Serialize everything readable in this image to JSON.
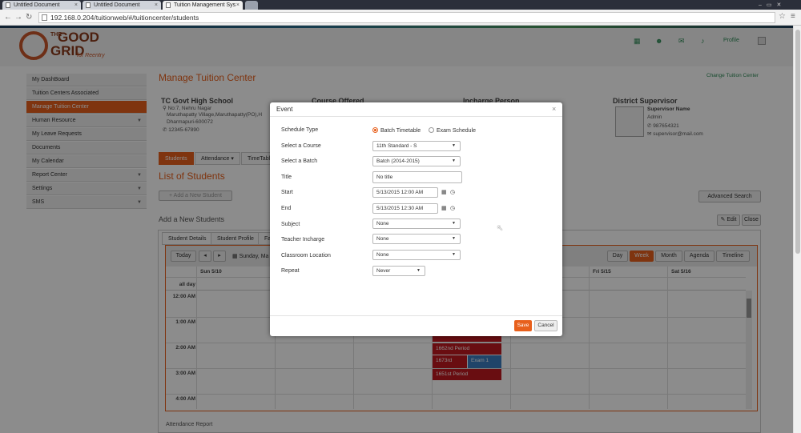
{
  "browser": {
    "tabs": [
      {
        "title": "Untitled Document"
      },
      {
        "title": "Untitled Document"
      },
      {
        "title": "Tuition Management Sys"
      }
    ],
    "url": "192.168.0.204/tuitionweb/#/tuitioncenter/students"
  },
  "header": {
    "logo_line1": "THE",
    "logo_line2": "GOOD",
    "logo_line3": "GRID",
    "logo_tagline": "for Reentry",
    "profile_label": "Profile"
  },
  "sidebar": {
    "items": [
      {
        "label": "My DashBoard"
      },
      {
        "label": "Tuition Centers Associated"
      },
      {
        "label": "Manage Tuition Center"
      },
      {
        "label": "Human Resource"
      },
      {
        "label": "My Leave Requests"
      },
      {
        "label": "Documents"
      },
      {
        "label": "My Calendar"
      },
      {
        "label": "Report Center"
      },
      {
        "label": "Settings"
      },
      {
        "label": "SMS"
      }
    ]
  },
  "main": {
    "page_title": "Manage Tuition Center",
    "change_center": "Change Tuition Center",
    "school": {
      "name": "TC Govt High School",
      "addr1": "No:7, Nehru Nagar",
      "addr2": "Maruthapatty Village,Maruthapatty(PO),H",
      "addr3": "Dharmapuri-600072",
      "phone": "12345-67890"
    },
    "course_offered": "Course Offered",
    "incharge": "Incharge Person",
    "district": {
      "heading": "District Supervisor",
      "name": "Supervisor Name",
      "role": "Admin",
      "phone": "987654321",
      "email": "supervisor@mail.com"
    },
    "tabs": [
      "Students",
      "Attendance",
      "TimeTabl"
    ],
    "list_title": "List of Students",
    "add_new_btn": "+ Add a New Student",
    "advanced_search": "Advanced Search",
    "add_new_heading": "Add a New Students",
    "edit": "Edit",
    "close": "Close",
    "subtabs": [
      "Student Details",
      "Student Profile",
      "Fa"
    ],
    "attendance_report": "Attendance Report"
  },
  "calendar": {
    "today": "Today",
    "prev": "◂",
    "next": "▸",
    "date_range": "Sunday, Ma",
    "views": [
      "Day",
      "Week",
      "Month",
      "Agenda",
      "Timeline"
    ],
    "active_view": "Week",
    "days": [
      "Sun 5/10",
      "Fri 5/15",
      "Sat 5/16"
    ],
    "allday": "all day",
    "times": [
      "12:00 AM",
      "1:00 AM",
      "2:00 AM",
      "3:00 AM",
      "4:00 AM"
    ],
    "events": [
      {
        "label": "1662nd Period"
      },
      {
        "label": "1673rd"
      },
      {
        "label": "Exam 1"
      },
      {
        "label": "1651st Period"
      }
    ]
  },
  "modal": {
    "title": "Event",
    "close_glyph": "×",
    "schedule_type_label": "Schedule Type",
    "schedule_options": [
      "Batch Timetable",
      "Exam Schedule"
    ],
    "course_label": "Select a Course",
    "course_value": "11th Standard - S",
    "batch_label": "Select a Batch",
    "batch_value": "Batch (2014-2015)",
    "title_label": "Title",
    "title_value": "No title",
    "start_label": "Start",
    "start_value": "5/13/2015 12:00 AM",
    "end_label": "End",
    "end_value": "5/13/2015 12:30 AM",
    "subject_label": "Subject",
    "subject_value": "None",
    "teacher_label": "Teacher Incharge",
    "teacher_value": "None",
    "classroom_label": "Classroom Location",
    "classroom_value": "None",
    "repeat_label": "Repeat",
    "repeat_value": "Never",
    "save": "Save",
    "cancel": "Cancel"
  },
  "colors": {
    "accent": "#e8601c",
    "event_red": "#c0191f",
    "event_blue": "#3b7dbf"
  }
}
